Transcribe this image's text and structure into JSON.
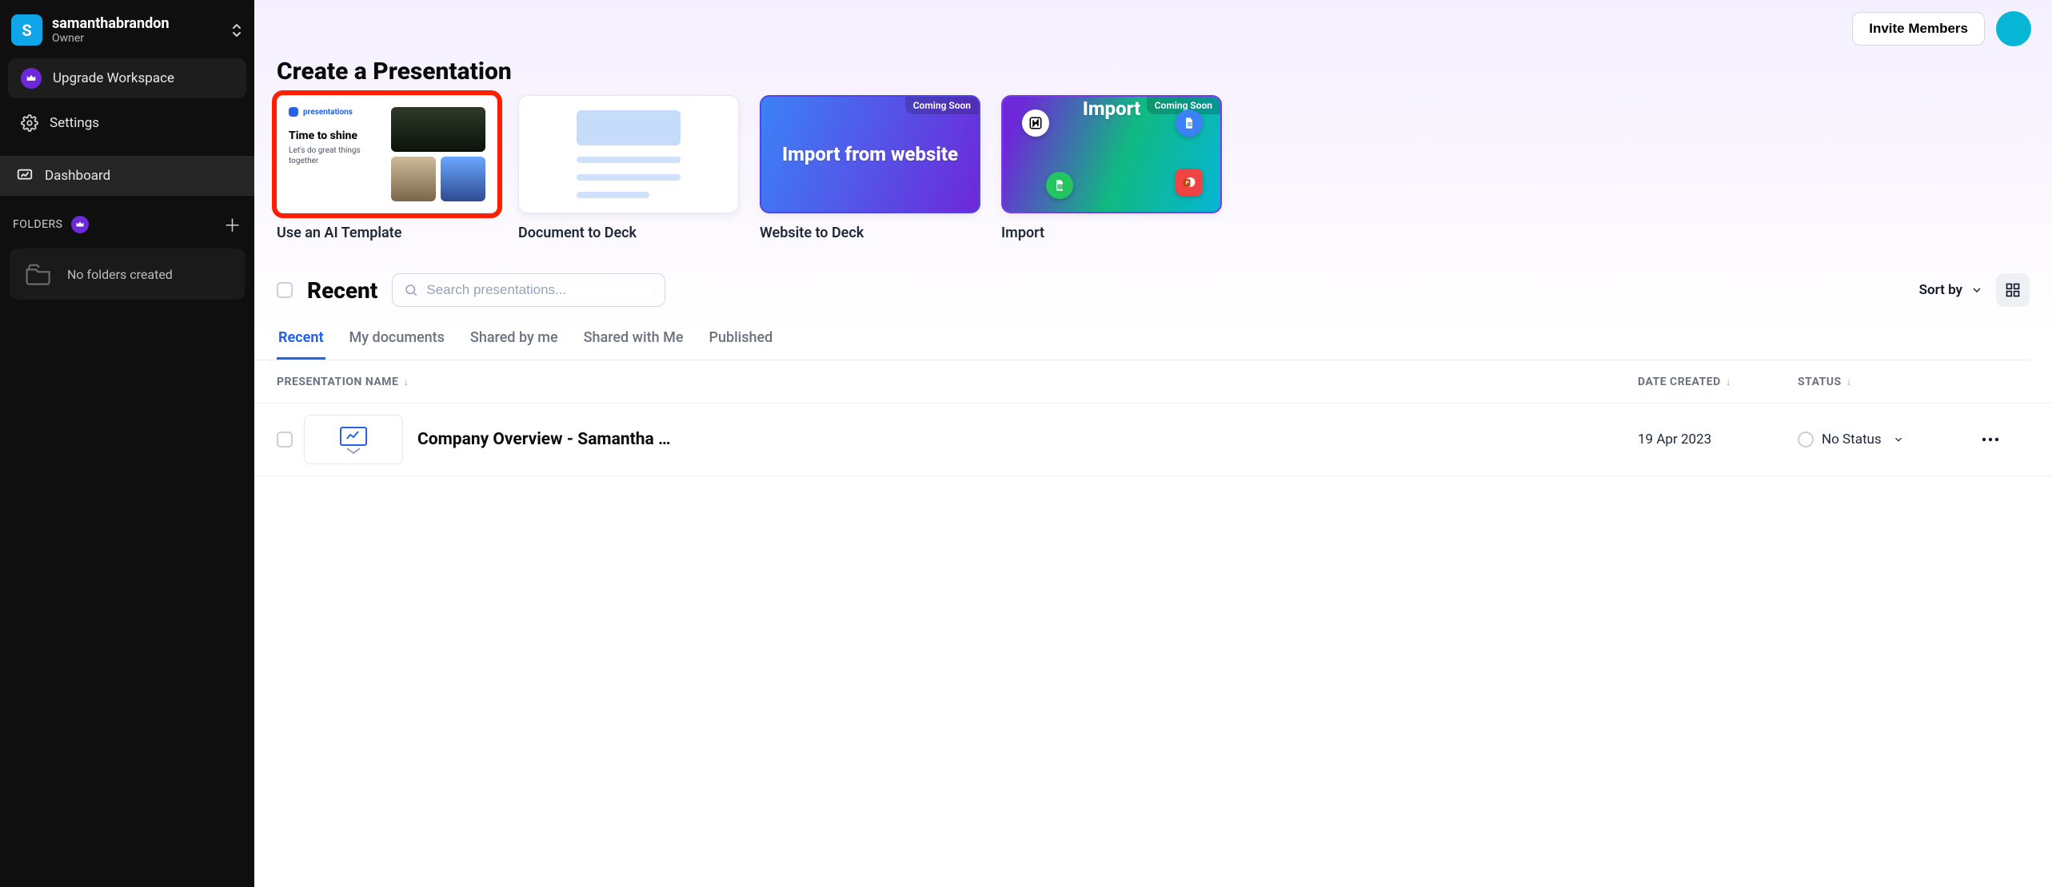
{
  "user": {
    "name": "samanthabrandon",
    "role": "Owner",
    "avatar_initial": "S"
  },
  "sidebar": {
    "upgrade": "Upgrade Workspace",
    "settings": "Settings",
    "dashboard": "Dashboard",
    "folders_label": "FOLDERS",
    "no_folders": "No folders created"
  },
  "topbar": {
    "invite": "Invite Members"
  },
  "create": {
    "title": "Create a Presentation",
    "coming_soon": "Coming Soon",
    "cards": [
      {
        "caption": "Use an AI Template",
        "brand": "presentations",
        "slide_title": "Time to shine",
        "slide_sub": "Let's do great things together"
      },
      {
        "caption": "Document to Deck"
      },
      {
        "caption": "Website to Deck",
        "hero": "Import from website"
      },
      {
        "caption": "Import",
        "hero": "Import"
      }
    ]
  },
  "recent": {
    "title": "Recent",
    "search_placeholder": "Search presentations...",
    "sort_label": "Sort by"
  },
  "tabs": [
    "Recent",
    "My documents",
    "Shared by me",
    "Shared with Me",
    "Published"
  ],
  "table": {
    "headers": {
      "name": "PRESENTATION NAME",
      "date": "DATE CREATED",
      "status": "STATUS"
    },
    "rows": [
      {
        "name": "Company Overview - Samantha …",
        "date": "19 Apr 2023",
        "status": "No Status"
      }
    ]
  }
}
